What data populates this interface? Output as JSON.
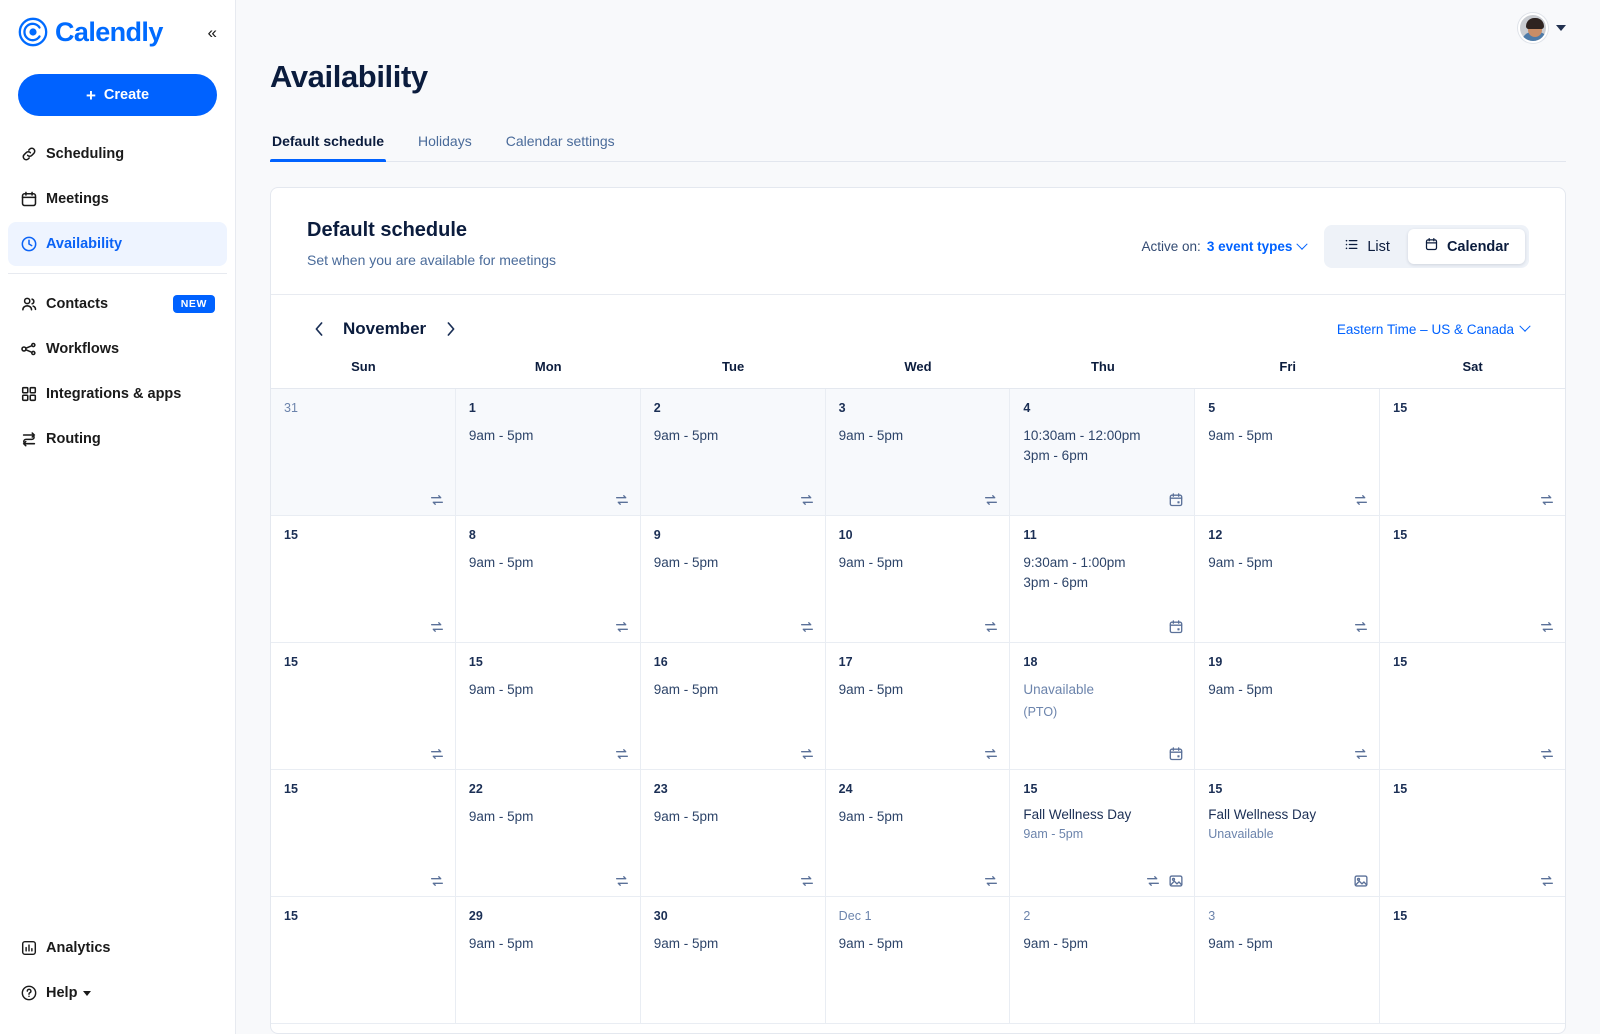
{
  "brand": {
    "name": "Calendly",
    "collapse_icon": "chevron-double-left-icon"
  },
  "sidebar": {
    "create_label": "Create",
    "items": [
      {
        "label": "Scheduling",
        "icon": "link-icon"
      },
      {
        "label": "Meetings",
        "icon": "calendar-icon"
      },
      {
        "label": "Availability",
        "icon": "clock-icon",
        "active": true
      }
    ],
    "items2": [
      {
        "label": "Contacts",
        "icon": "people-icon",
        "badge": "NEW"
      },
      {
        "label": "Workflows",
        "icon": "workflow-icon"
      },
      {
        "label": "Integrations & apps",
        "icon": "grid-icon"
      },
      {
        "label": "Routing",
        "icon": "routing-icon"
      }
    ],
    "bottom": [
      {
        "label": "Analytics",
        "icon": "analytics-icon"
      },
      {
        "label": "Help",
        "icon": "question-circle-icon",
        "caret": true
      }
    ]
  },
  "topbar": {
    "avatar": "avatar",
    "caret_icon": "chevron-down-icon"
  },
  "page": {
    "title": "Availability",
    "tabs": [
      {
        "label": "Default schedule",
        "active": true
      },
      {
        "label": "Holidays",
        "active": false
      },
      {
        "label": "Calendar settings",
        "active": false
      }
    ]
  },
  "schedule": {
    "title": "Default schedule",
    "subtitle": "Set when you are available for meetings",
    "active_on_label": "Active on:",
    "active_on_value": "3 event types",
    "view_list": "List",
    "view_calendar": "Calendar",
    "view_selected": "Calendar"
  },
  "calendar": {
    "month": "November",
    "prev_icon": "chevron-left-icon",
    "next_icon": "chevron-right-icon",
    "timezone": "Eastern Time – US & Canada",
    "dow": [
      "Sun",
      "Mon",
      "Tue",
      "Wed",
      "Thu",
      "Fri",
      "Sat"
    ],
    "cells": [
      {
        "day": "31",
        "dim": true,
        "muted": true,
        "icons": [
          "repeat-icon"
        ]
      },
      {
        "day": "1",
        "dim": false,
        "muted": true,
        "slot": "9am - 5pm",
        "icons": [
          "repeat-icon"
        ]
      },
      {
        "day": "2",
        "dim": false,
        "muted": true,
        "slot": "9am - 5pm",
        "icons": [
          "repeat-icon"
        ]
      },
      {
        "day": "3",
        "dim": false,
        "muted": true,
        "slot": "9am - 5pm",
        "icons": [
          "repeat-icon"
        ]
      },
      {
        "day": "4",
        "dim": false,
        "muted": true,
        "slot": "10:30am - 12:00pm\n3pm - 6pm",
        "icons": [
          "calendar-icon"
        ]
      },
      {
        "day": "5",
        "dim": false,
        "muted": false,
        "slot": "9am - 5pm",
        "icons": [
          "repeat-icon"
        ]
      },
      {
        "day": "15",
        "dim": false,
        "muted": false,
        "icons": [
          "repeat-icon"
        ]
      },
      {
        "day": "15",
        "dim": false,
        "muted": false,
        "icons": [
          "repeat-icon"
        ]
      },
      {
        "day": "8",
        "dim": false,
        "muted": false,
        "slot": "9am - 5pm",
        "icons": [
          "repeat-icon"
        ]
      },
      {
        "day": "9",
        "dim": false,
        "muted": false,
        "slot": "9am - 5pm",
        "icons": [
          "repeat-icon"
        ]
      },
      {
        "day": "10",
        "dim": false,
        "muted": false,
        "slot": "9am - 5pm",
        "icons": [
          "repeat-icon"
        ]
      },
      {
        "day": "11",
        "dim": false,
        "muted": false,
        "slot": "9:30am - 1:00pm\n3pm - 6pm",
        "icons": [
          "calendar-icon"
        ]
      },
      {
        "day": "12",
        "dim": false,
        "muted": false,
        "slot": "9am - 5pm",
        "icons": [
          "repeat-icon"
        ]
      },
      {
        "day": "15",
        "dim": false,
        "muted": false,
        "icons": [
          "repeat-icon"
        ]
      },
      {
        "day": "15",
        "dim": false,
        "muted": false,
        "icons": [
          "repeat-icon"
        ]
      },
      {
        "day": "15",
        "dim": false,
        "muted": false,
        "slot": "9am - 5pm",
        "icons": [
          "repeat-icon"
        ]
      },
      {
        "day": "16",
        "dim": false,
        "muted": false,
        "slot": "9am - 5pm",
        "icons": [
          "repeat-icon"
        ]
      },
      {
        "day": "17",
        "dim": false,
        "muted": false,
        "slot": "9am - 5pm",
        "icons": [
          "repeat-icon"
        ]
      },
      {
        "day": "18",
        "dim": false,
        "muted": false,
        "slot": "Unavailable",
        "slot_gray": true,
        "sub": "(PTO)",
        "icons": [
          "calendar-icon"
        ]
      },
      {
        "day": "19",
        "dim": false,
        "muted": false,
        "slot": "9am - 5pm",
        "icons": [
          "repeat-icon"
        ]
      },
      {
        "day": "15",
        "dim": false,
        "muted": false,
        "icons": [
          "repeat-icon"
        ]
      },
      {
        "day": "15",
        "dim": false,
        "muted": false,
        "icons": [
          "repeat-icon"
        ]
      },
      {
        "day": "22",
        "dim": false,
        "muted": false,
        "slot": "9am - 5pm",
        "icons": [
          "repeat-icon"
        ]
      },
      {
        "day": "23",
        "dim": false,
        "muted": false,
        "slot": "9am - 5pm",
        "icons": [
          "repeat-icon"
        ]
      },
      {
        "day": "24",
        "dim": false,
        "muted": false,
        "slot": "9am - 5pm",
        "icons": [
          "repeat-icon"
        ]
      },
      {
        "day": "15",
        "dim": false,
        "muted": false,
        "title": "Fall Wellness Day",
        "sub": "9am - 5pm",
        "icons": [
          "repeat-icon",
          "image-icon"
        ]
      },
      {
        "day": "15",
        "dim": false,
        "muted": false,
        "title": "Fall Wellness Day",
        "sub": "Unavailable",
        "icons": [
          "image-icon"
        ]
      },
      {
        "day": "15",
        "dim": false,
        "muted": false,
        "icons": [
          "repeat-icon"
        ]
      },
      {
        "day": "15",
        "dim": false,
        "muted": false
      },
      {
        "day": "29",
        "dim": false,
        "muted": false,
        "slot": "9am - 5pm"
      },
      {
        "day": "30",
        "dim": false,
        "muted": false,
        "slot": "9am - 5pm"
      },
      {
        "day": "Dec 1",
        "dim": true,
        "muted": false,
        "slot": "9am - 5pm"
      },
      {
        "day": "2",
        "dim": true,
        "muted": false,
        "slot": "9am - 5pm"
      },
      {
        "day": "3",
        "dim": true,
        "muted": false,
        "slot": "9am - 5pm"
      },
      {
        "day": "15",
        "dim": false,
        "muted": false
      }
    ]
  },
  "colors": {
    "accent": "#0062ff",
    "title": "#0b1c3d",
    "muted_text": "#6c84ac",
    "cell_muted_bg": "#f7f9fc",
    "border": "#e9edf3"
  }
}
